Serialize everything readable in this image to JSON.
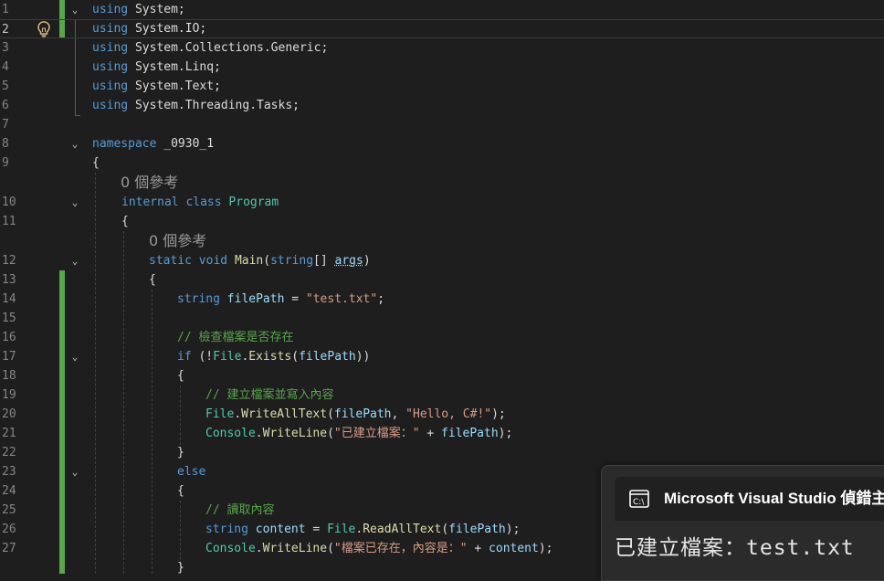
{
  "editor": {
    "current_line": "2",
    "codelens": {
      "class_refs": "0 個參考",
      "method_refs": "0 個參考"
    },
    "line_numbers": [
      "1",
      "2",
      "3",
      "4",
      "5",
      "6",
      "7",
      "8",
      "9",
      "10",
      "11",
      "12",
      "13",
      "14",
      "15",
      "16",
      "17",
      "18",
      "19",
      "20",
      "21",
      "22",
      "23",
      "24",
      "25",
      "26",
      "27"
    ],
    "lines": {
      "l1": [
        "using",
        " System;"
      ],
      "l2": [
        "using",
        " System.IO;"
      ],
      "l3": [
        "using",
        " System.Collections.Generic;"
      ],
      "l4": [
        "using",
        " System.Linq;"
      ],
      "l5": [
        "using",
        " System.Text;"
      ],
      "l6": [
        "using",
        " System.Threading.Tasks;"
      ],
      "l8": [
        "namespace",
        " _0930_1"
      ],
      "l9": [
        "{"
      ],
      "l10": [
        "internal",
        " ",
        "class",
        " ",
        "Program"
      ],
      "l11": [
        "{"
      ],
      "l12": [
        "static",
        " ",
        "void",
        " ",
        "Main",
        "(",
        "string",
        "[] ",
        "args",
        ")"
      ],
      "l13": [
        "{"
      ],
      "l14": [
        "string",
        " ",
        "filePath",
        " = ",
        "\"test.txt\"",
        ";"
      ],
      "l16": [
        "// 檢查檔案是否存在"
      ],
      "l17": [
        "if",
        " (!",
        "File",
        ".",
        "Exists",
        "(",
        "filePath",
        "))"
      ],
      "l18": [
        "{"
      ],
      "l19": [
        "// 建立檔案並寫入內容"
      ],
      "l20": [
        "File",
        ".",
        "WriteAllText",
        "(",
        "filePath",
        ", ",
        "\"Hello, C#!\"",
        ");"
      ],
      "l21": [
        "Console",
        ".",
        "WriteLine",
        "(",
        "\"已建立檔案：\"",
        " + ",
        "filePath",
        ");"
      ],
      "l22": [
        "}"
      ],
      "l23": [
        "else"
      ],
      "l24": [
        "{"
      ],
      "l25": [
        "// 讀取內容"
      ],
      "l26": [
        "string",
        " ",
        "content",
        " = ",
        "File",
        ".",
        "ReadAllText",
        "(",
        "filePath",
        ");"
      ],
      "l27": [
        "Console",
        ".",
        "WriteLine",
        "(",
        "\"檔案已存在，內容是：\"",
        " + ",
        "content",
        ");"
      ],
      "l28": [
        "}"
      ]
    }
  },
  "console_popup": {
    "title": "Microsoft Visual Studio 偵錯主",
    "output": "已建立檔案：test.txt"
  },
  "icons": {
    "lightbulb": "lightbulb-icon",
    "fold": "chevron-down-icon",
    "console": "console-app-icon"
  },
  "colors": {
    "background": "#1e1e1e",
    "keyword": "#569cd6",
    "type": "#4ec9b0",
    "method": "#dcdcaa",
    "variable": "#9cdcfe",
    "string": "#d69d85",
    "comment": "#57a64a",
    "change_bar": "#57a64a"
  }
}
